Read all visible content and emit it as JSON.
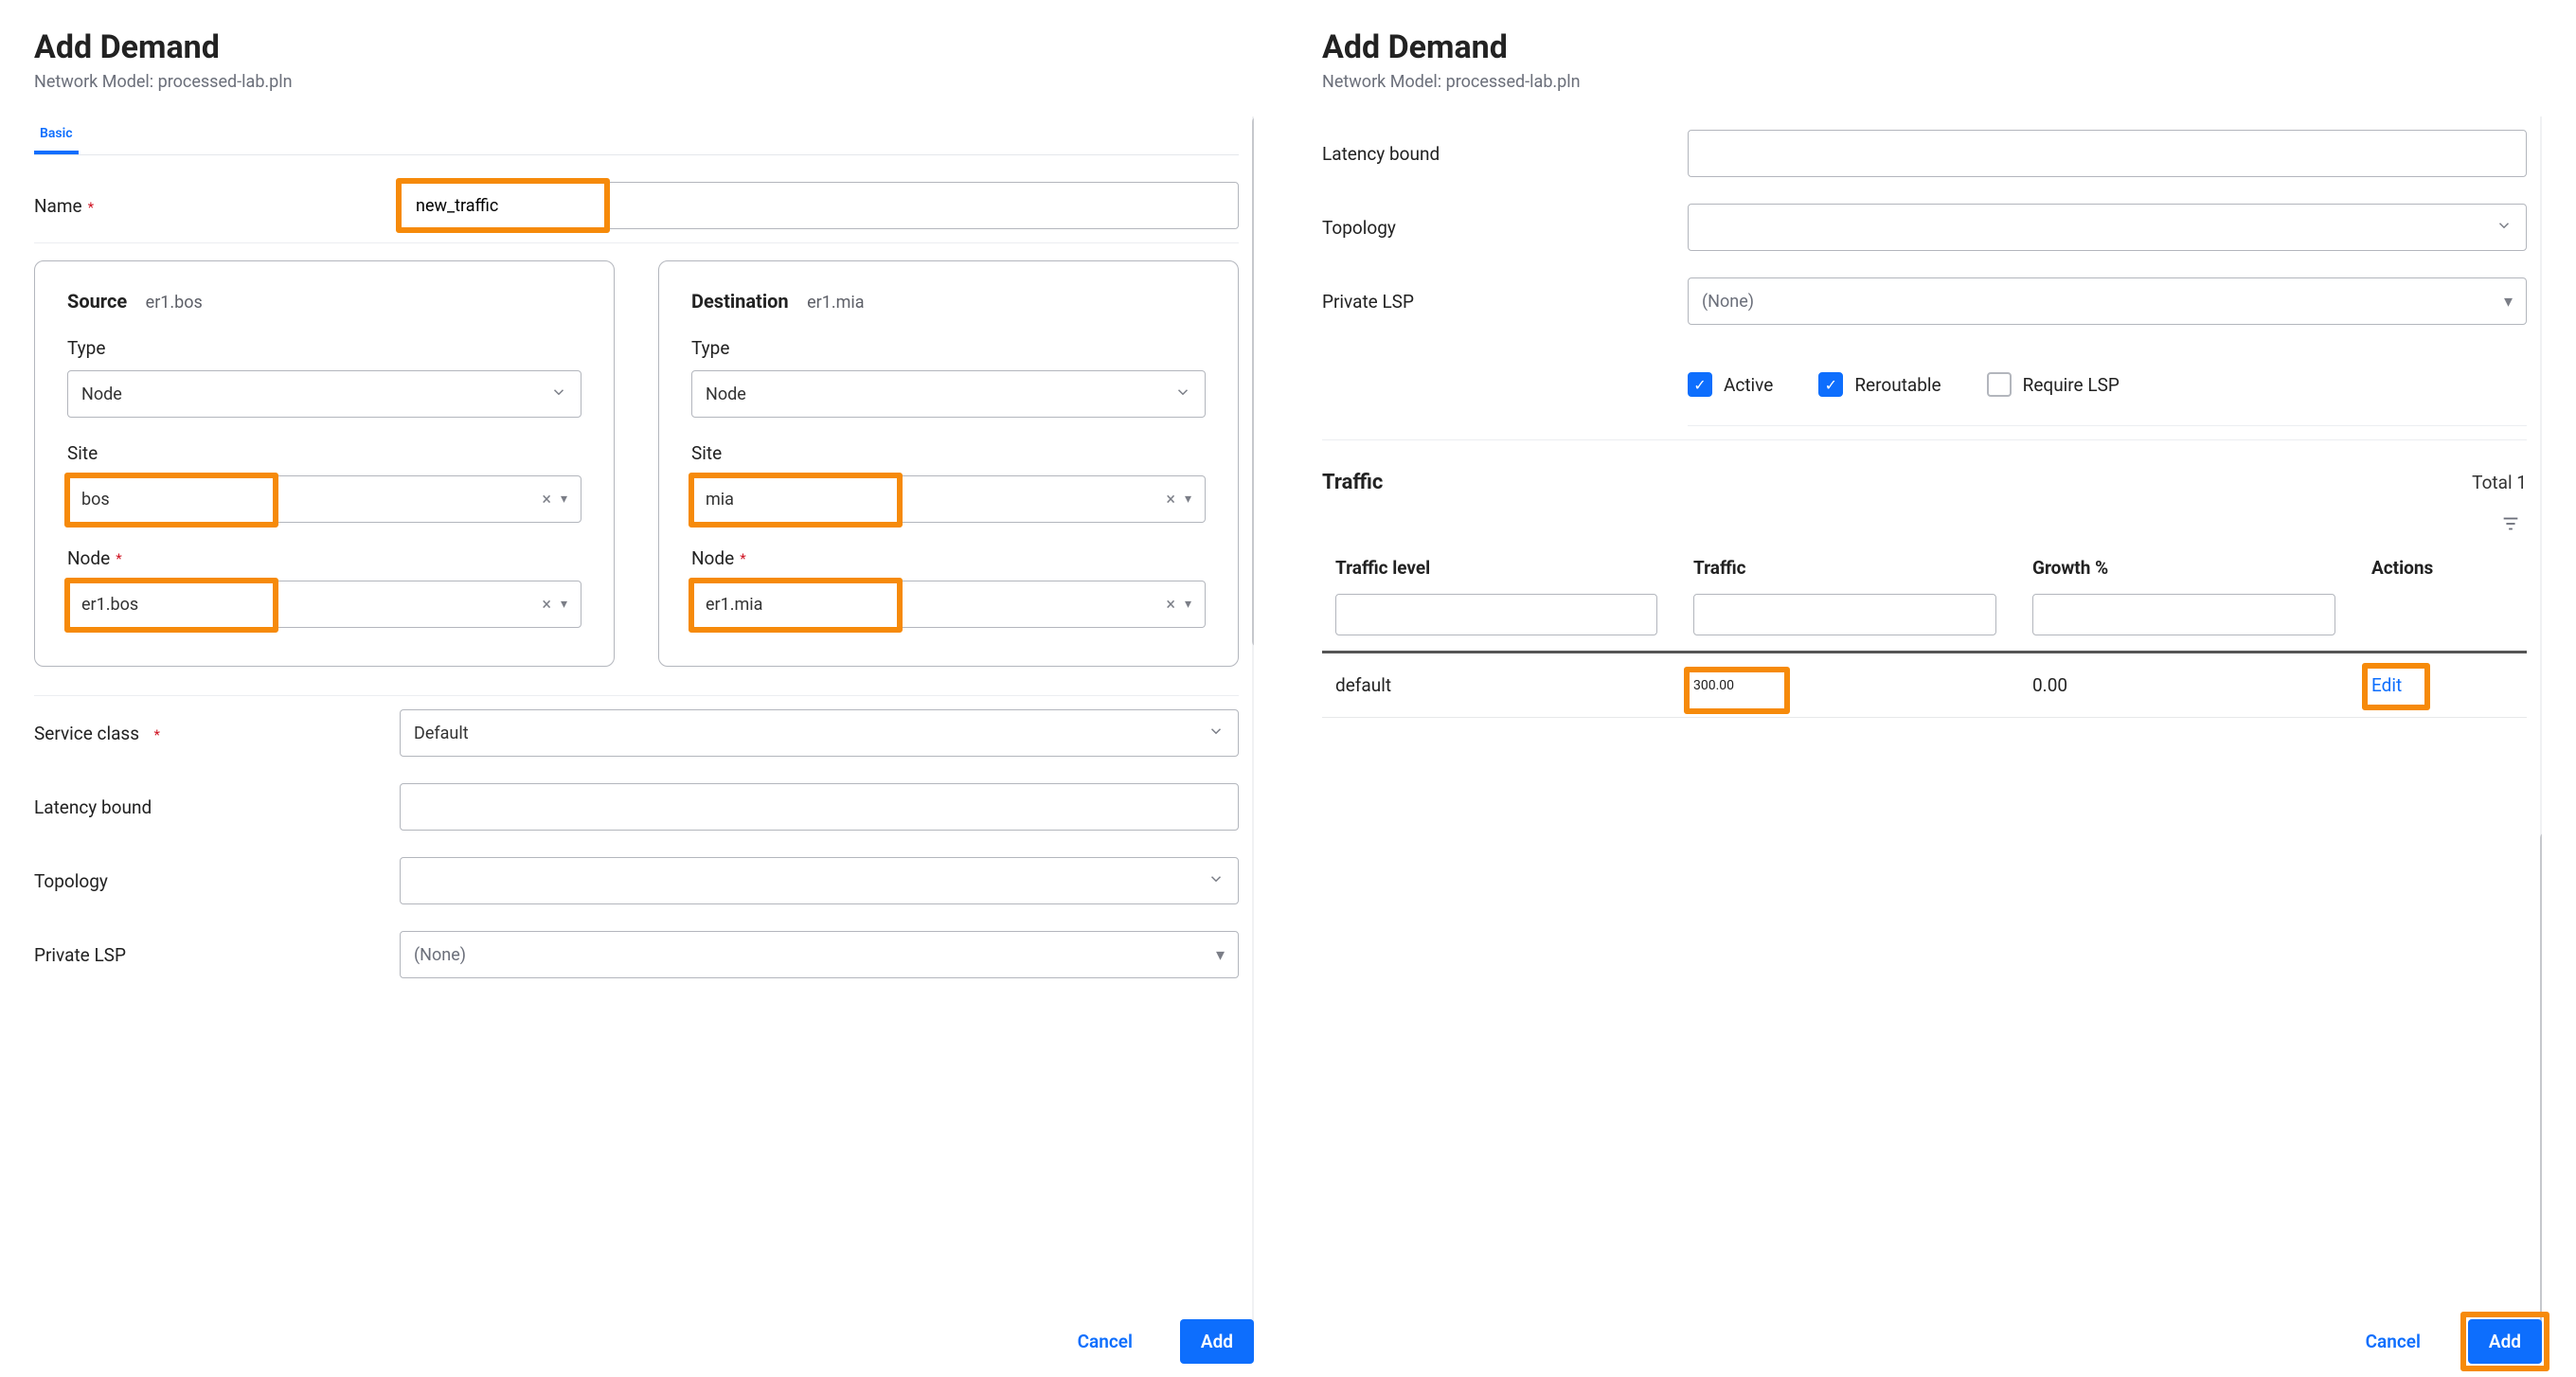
{
  "left": {
    "title": "Add Demand",
    "subtitle": "Network Model: processed-lab.pln",
    "tab_basic": "Basic",
    "labels": {
      "name": "Name",
      "service_class": "Service class",
      "latency_bound": "Latency bound",
      "topology": "Topology",
      "private_lsp": "Private LSP"
    },
    "values": {
      "name": "new_traffic",
      "service_class": "Default",
      "latency_bound": "",
      "topology": "",
      "private_lsp": "(None)"
    },
    "source": {
      "title": "Source",
      "subtitle": "er1.bos",
      "type_label": "Type",
      "type_value": "Node",
      "site_label": "Site",
      "site_value": "bos",
      "node_label": "Node",
      "node_value": "er1.bos"
    },
    "destination": {
      "title": "Destination",
      "subtitle": "er1.mia",
      "type_label": "Type",
      "type_value": "Node",
      "site_label": "Site",
      "site_value": "mia",
      "node_label": "Node",
      "node_value": "er1.mia"
    },
    "buttons": {
      "cancel": "Cancel",
      "add": "Add"
    }
  },
  "right": {
    "title": "Add Demand",
    "subtitle": "Network Model: processed-lab.pln",
    "labels": {
      "latency_bound": "Latency bound",
      "topology": "Topology",
      "private_lsp": "Private LSP"
    },
    "values": {
      "latency_bound": "",
      "topology": "",
      "private_lsp": "(None)"
    },
    "checks": {
      "active": "Active",
      "reroutable": "Reroutable",
      "require_lsp": "Require LSP"
    },
    "checks_state": {
      "active": true,
      "reroutable": true,
      "require_lsp": false
    },
    "traffic": {
      "title": "Traffic",
      "total_label": "Total 1",
      "columns": {
        "c1": "Traffic level",
        "c2": "Traffic",
        "c3": "Growth %",
        "c4": "Actions"
      },
      "rows": [
        {
          "level": "default",
          "traffic": "300.00",
          "growth": "0.00",
          "action": "Edit"
        }
      ]
    },
    "buttons": {
      "cancel": "Cancel",
      "add": "Add"
    }
  }
}
